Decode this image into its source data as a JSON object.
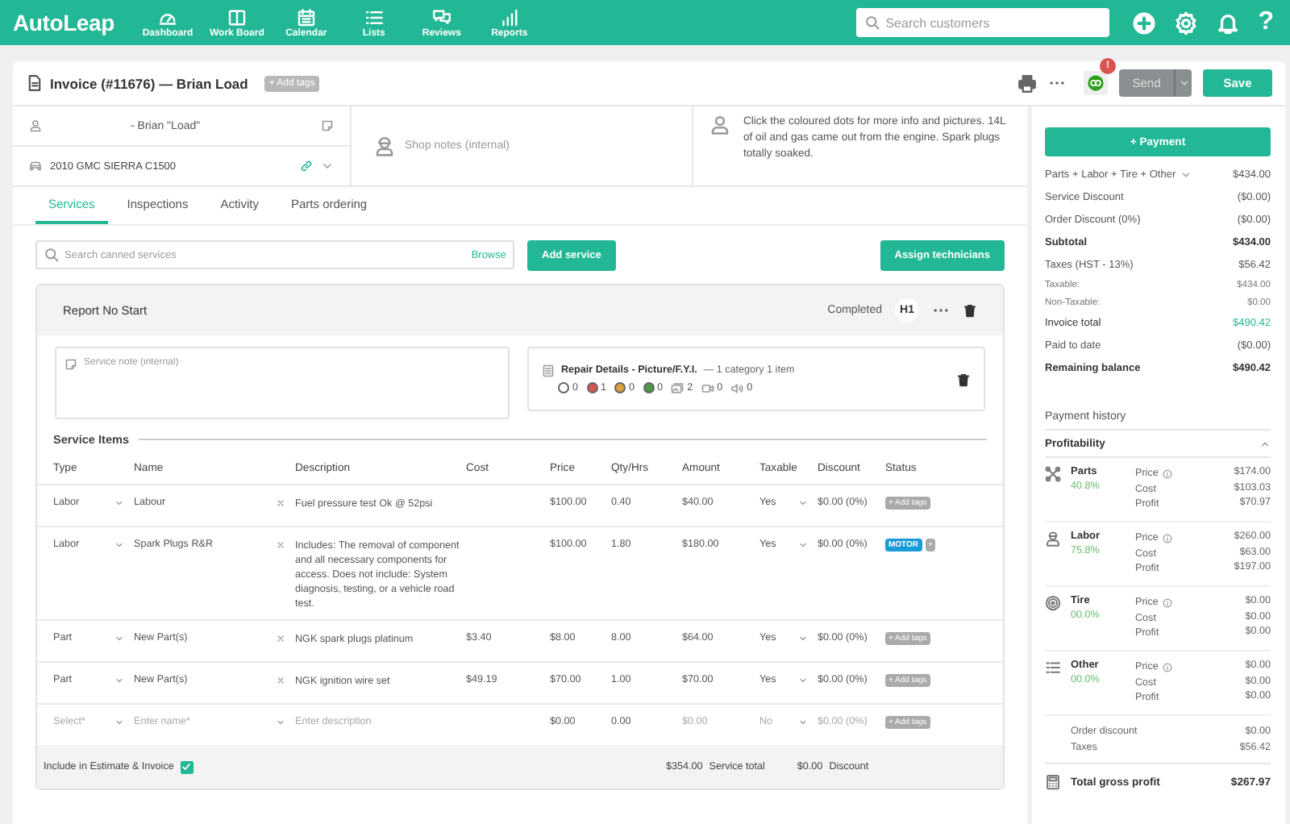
{
  "header": {
    "logo": "AutoLeap",
    "nav": [
      {
        "label": "Dashboard"
      },
      {
        "label": "Work Board"
      },
      {
        "label": "Calendar"
      },
      {
        "label": "Lists"
      },
      {
        "label": "Reviews"
      },
      {
        "label": "Reports"
      }
    ],
    "search": {
      "placeholder": "Search customers"
    },
    "help": "?"
  },
  "invoice": {
    "title": "Invoice (#11676) — Brian Load",
    "add_tags": "+ Add tags",
    "sync_badge": "!",
    "send": "Send",
    "save": "Save"
  },
  "customer": {
    "name": "- Brian \"Load\"",
    "vehicle": "2010 GMC SIERRA C1500",
    "shop_notes": {
      "placeholder": "Shop notes (internal)"
    },
    "customer_note": "Click the coloured dots for more info and pictures. 14L of oil and gas came out from the engine. Spark plugs totally soaked."
  },
  "tabs": [
    {
      "label": "Services",
      "selected": true
    },
    {
      "label": "Inspections",
      "selected": false
    },
    {
      "label": "Activity",
      "selected": false
    },
    {
      "label": "Parts ordering",
      "selected": false
    }
  ],
  "services_toolbar": {
    "search": {
      "placeholder": "Search canned services"
    },
    "browse": "Browse",
    "add_service": "Add service",
    "assign": "Assign technicians"
  },
  "service": {
    "title": "Report No Start",
    "status": "Completed",
    "technician": "H1",
    "note": {
      "placeholder": "Service note (internal)"
    },
    "repair_details": {
      "title": "Repair Details - Picture/F.Y.I.",
      "summary": "— 1 category 1 item",
      "counts": [
        {
          "kind": "dot",
          "color": "#ffffff",
          "count": "0"
        },
        {
          "kind": "dot",
          "color": "#d9534f",
          "count": "1"
        },
        {
          "kind": "dot",
          "color": "#e0a040",
          "count": "0"
        },
        {
          "kind": "dot",
          "color": "#4a9a4a",
          "count": "0"
        },
        {
          "kind": "photo",
          "count": "2"
        },
        {
          "kind": "video",
          "count": "0"
        },
        {
          "kind": "audio",
          "count": "0"
        }
      ]
    },
    "items_heading": "Service Items",
    "columns": [
      "Type",
      "Name",
      "Description",
      "Cost",
      "Price",
      "Qty/Hrs",
      "Amount",
      "Taxable",
      "Discount",
      "Status"
    ],
    "rows": [
      {
        "kind": "item",
        "type": "Labor",
        "name": "Labour",
        "description": "Fuel pressure test Ok @ 52psi",
        "price": "$100.00",
        "qty": "0.40",
        "amount": "$40.00",
        "taxable": "Yes",
        "discount": "$0.00 (0%)",
        "add_tag": "+ Add tags"
      },
      {
        "kind": "item",
        "type": "Labor",
        "name": "Spark Plugs R&R",
        "description": "Includes: The removal of component and all necessary components for access. Does not include: System diagnosis, testing, or a vehicle road test.",
        "price": "$100.00",
        "qty": "1.80",
        "amount": "$180.00",
        "taxable": "Yes",
        "discount": "$0.00 (0%)",
        "tags": [
          {
            "label": "MOTOR",
            "color": "#1a9ad6"
          }
        ],
        "add_tag": "+"
      },
      {
        "kind": "item",
        "type": "Part",
        "name": "New Part(s)",
        "description": "NGK spark plugs platinum",
        "cost": "$3.40",
        "price": "$8.00",
        "qty": "8.00",
        "amount": "$64.00",
        "taxable": "Yes",
        "discount": "$0.00 (0%)",
        "add_tag": "+ Add tags"
      },
      {
        "kind": "item",
        "type": "Part",
        "name": "New Part(s)",
        "description": "NGK ignition wire set",
        "cost": "$49.19",
        "price": "$70.00",
        "qty": "1.00",
        "amount": "$70.00",
        "taxable": "Yes",
        "discount": "$0.00 (0%)",
        "add_tag": "+ Add tags"
      },
      {
        "kind": "new",
        "placeholders": {
          "type": "Select*",
          "name": "Enter  name*",
          "description": "Enter description"
        },
        "price": "$0.00",
        "qty": "0.00",
        "amount": "$0.00",
        "taxable": "No",
        "discount": "$0.00 (0%)",
        "add_tag": "+ Add tags"
      }
    ],
    "include": {
      "label": "Include in Estimate & Invoice",
      "checked": true
    },
    "total": "$354.00",
    "total_label": "Service total",
    "discount": "$0.00",
    "discount_label": "Discount"
  },
  "summary": {
    "payment": "+ Payment",
    "rows": [
      {
        "kind": "breakdown",
        "label": "Parts + Labor + Tire + Other",
        "value": "$434.00"
      },
      {
        "kind": "regular",
        "label": "Service Discount",
        "value": "($0.00)"
      },
      {
        "kind": "regular",
        "label": "Order Discount (0%)",
        "value": "($0.00)"
      },
      {
        "kind": "strong",
        "label": "Subtotal",
        "value": "$434.00"
      },
      {
        "kind": "regular",
        "label": "Taxes (HST - 13%)",
        "value": "$56.42"
      },
      {
        "kind": "minor",
        "label": "Taxable:",
        "value": "$434.00"
      },
      {
        "kind": "minor",
        "label": "Non-Taxable:",
        "value": "$0.00"
      },
      {
        "kind": "total",
        "label": "Invoice total",
        "value": "$490.42"
      },
      {
        "kind": "regular",
        "label": "Paid to date",
        "value": "($0.00)"
      },
      {
        "kind": "strong",
        "label": "Remaining balance",
        "value": "$490.42"
      }
    ],
    "payment_history": "Payment history"
  },
  "profitability": {
    "title": "Profitability",
    "expanded": true,
    "categories": [
      {
        "kind": "parts",
        "label": "Parts",
        "percent": "40.8%",
        "lines": [
          {
            "label": "Price",
            "value": "$174.00"
          },
          {
            "label": "Cost",
            "value": "$103.03"
          },
          {
            "label": "Profit",
            "value": "$70.97"
          }
        ]
      },
      {
        "kind": "labor",
        "label": "Labor",
        "percent": "75.8%",
        "lines": [
          {
            "label": "Price",
            "value": "$260.00"
          },
          {
            "label": "Cost",
            "value": "$63.00"
          },
          {
            "label": "Profit",
            "value": "$197.00"
          }
        ]
      },
      {
        "kind": "tire",
        "label": "Tire",
        "percent": "00.0%",
        "lines": [
          {
            "label": "Price",
            "value": "$0.00"
          },
          {
            "label": "Cost",
            "value": "$0.00"
          },
          {
            "label": "Profit",
            "value": "$0.00"
          }
        ]
      },
      {
        "kind": "other",
        "label": "Other",
        "percent": "00.0%",
        "lines": [
          {
            "label": "Price",
            "value": "$0.00"
          },
          {
            "label": "Cost",
            "value": "$0.00"
          },
          {
            "label": "Profit",
            "value": "$0.00"
          }
        ]
      }
    ],
    "extras": [
      {
        "label": "Order discount",
        "value": "$0.00"
      },
      {
        "label": "Taxes",
        "value": "$56.42"
      }
    ],
    "total_label": "Total gross profit",
    "total": "$267.97"
  }
}
